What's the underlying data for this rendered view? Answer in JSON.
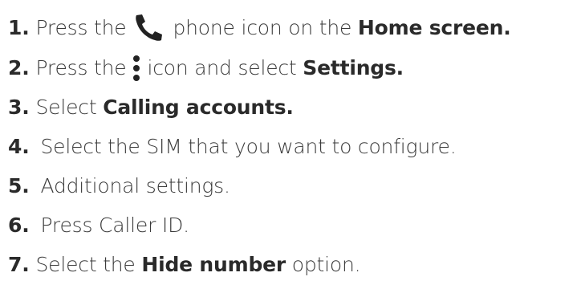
{
  "steps": [
    {
      "number": "1.",
      "parts": {
        "a": "Press the",
        "b": "phone icon on the",
        "c": "Home screen."
      }
    },
    {
      "number": "2.",
      "parts": {
        "a": "Press the",
        "b": "icon and select",
        "c": "Settings."
      }
    },
    {
      "number": "3.",
      "parts": {
        "a": "Select",
        "b": "Calling accounts."
      }
    },
    {
      "number": "4.",
      "parts": {
        "a": "Select the SIM that you want to configure."
      }
    },
    {
      "number": "5.",
      "parts": {
        "a": "Additional settings."
      }
    },
    {
      "number": "6.",
      "parts": {
        "a": "Press Caller ID."
      }
    },
    {
      "number": "7.",
      "parts": {
        "a": "Select the",
        "b": "Hide number",
        "c": "option."
      }
    }
  ],
  "icons": {
    "phone": "phone-icon",
    "more": "more-vert-icon"
  },
  "colors": {
    "text": "#3a3a3a",
    "bold_text": "#2a2a2a",
    "icon": "#222222",
    "background": "#ffffff"
  }
}
